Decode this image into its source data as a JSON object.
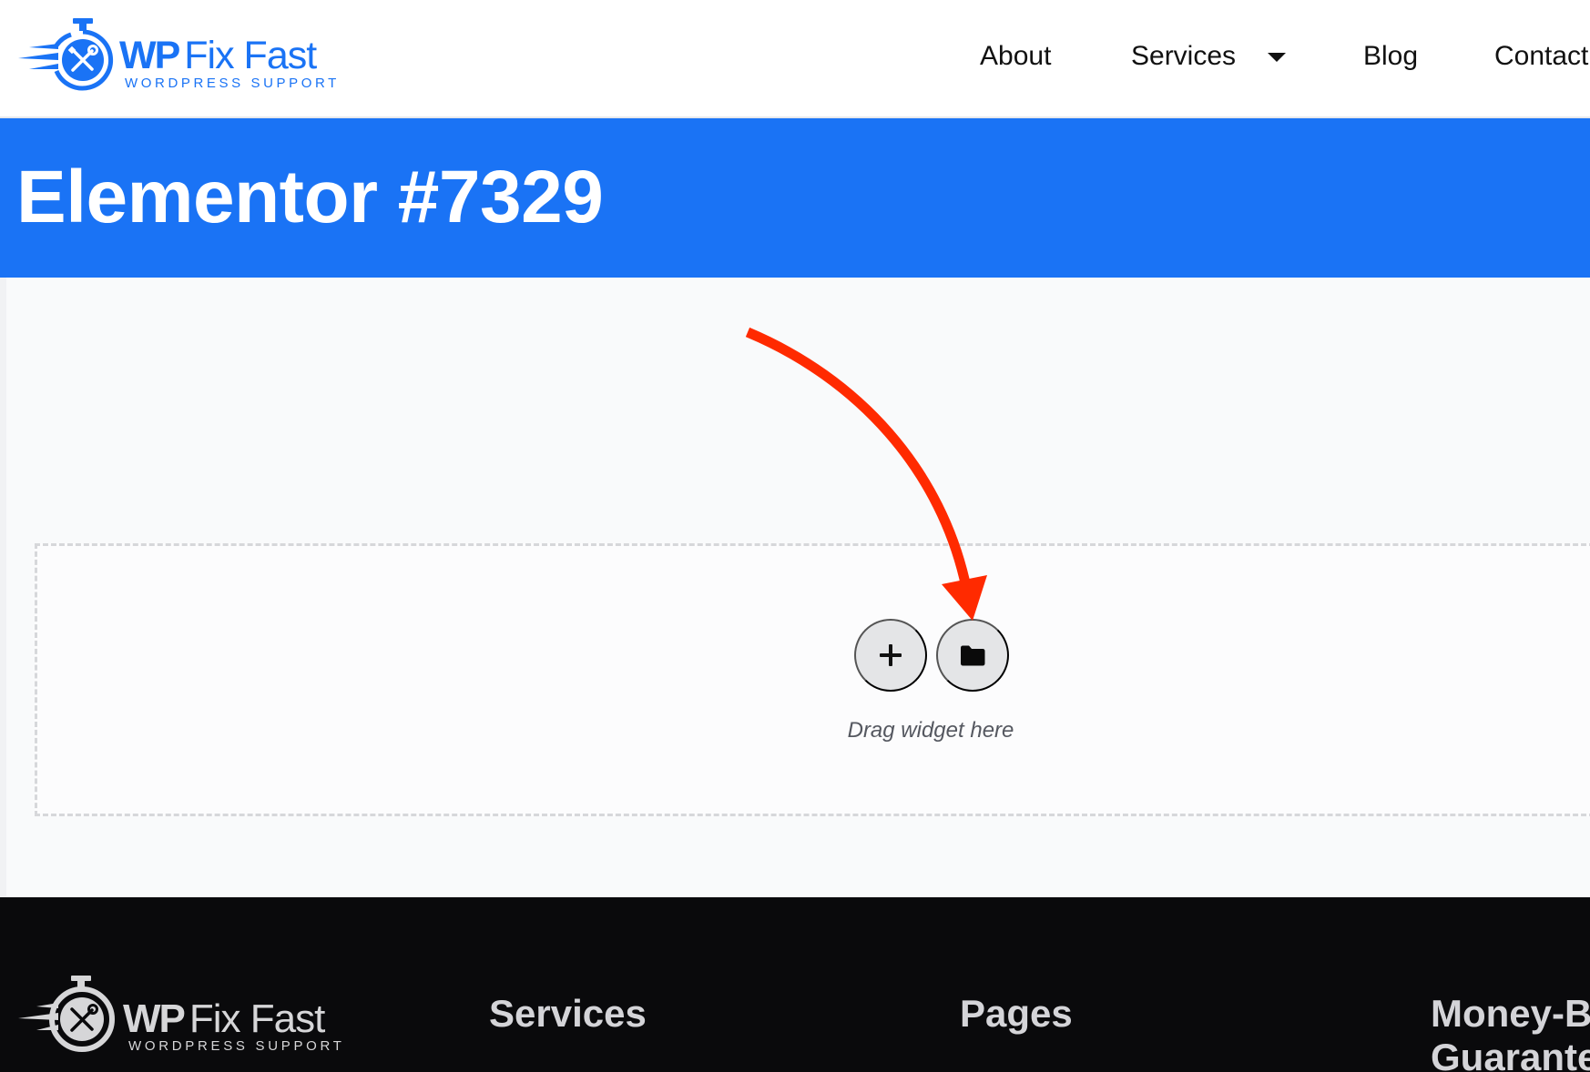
{
  "header": {
    "logo": {
      "brand_bold": "WP",
      "brand_light": "Fix Fast",
      "tagline": "WORDPRESS SUPPORT",
      "icon": "stopwatch-wrench-icon"
    },
    "nav": [
      {
        "label": "About"
      },
      {
        "label": "Services",
        "has_dropdown": true,
        "icon": "caret-down-icon"
      },
      {
        "label": "Blog"
      },
      {
        "label": "Contact"
      }
    ]
  },
  "title_band": {
    "title": "Elementor #7329"
  },
  "editor": {
    "add_section_icon": "plus-icon",
    "add_template_icon": "folder-icon",
    "drop_hint": "Drag widget here",
    "annotation": "red-arrow-pointing-to-folder-button"
  },
  "footer": {
    "logo": {
      "brand_bold": "WP",
      "brand_light": "Fix Fast",
      "tagline": "WORDPRESS SUPPORT"
    },
    "headings": [
      "Services",
      "Pages",
      "Money-Back Guarantee"
    ]
  },
  "colors": {
    "brand_blue": "#1a73f5",
    "footer_bg": "#0a0a0c",
    "annotation_red": "#ff2a00",
    "content_bg": "#f9fafb"
  }
}
